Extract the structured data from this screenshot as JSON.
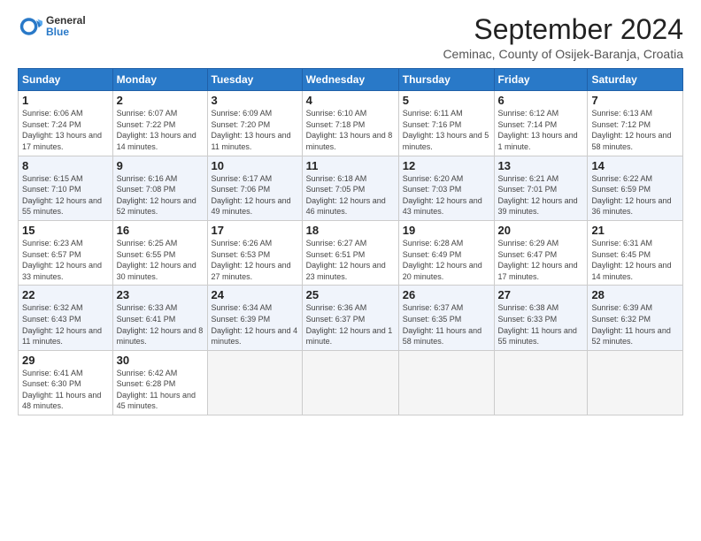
{
  "header": {
    "logo_general": "General",
    "logo_blue": "Blue",
    "month_title": "September 2024",
    "location": "Ceminac, County of Osijek-Baranja, Croatia"
  },
  "days_of_week": [
    "Sunday",
    "Monday",
    "Tuesday",
    "Wednesday",
    "Thursday",
    "Friday",
    "Saturday"
  ],
  "weeks": [
    [
      {
        "day": 1,
        "info": "Sunrise: 6:06 AM\nSunset: 7:24 PM\nDaylight: 13 hours and 17 minutes."
      },
      {
        "day": 2,
        "info": "Sunrise: 6:07 AM\nSunset: 7:22 PM\nDaylight: 13 hours and 14 minutes."
      },
      {
        "day": 3,
        "info": "Sunrise: 6:09 AM\nSunset: 7:20 PM\nDaylight: 13 hours and 11 minutes."
      },
      {
        "day": 4,
        "info": "Sunrise: 6:10 AM\nSunset: 7:18 PM\nDaylight: 13 hours and 8 minutes."
      },
      {
        "day": 5,
        "info": "Sunrise: 6:11 AM\nSunset: 7:16 PM\nDaylight: 13 hours and 5 minutes."
      },
      {
        "day": 6,
        "info": "Sunrise: 6:12 AM\nSunset: 7:14 PM\nDaylight: 13 hours and 1 minute."
      },
      {
        "day": 7,
        "info": "Sunrise: 6:13 AM\nSunset: 7:12 PM\nDaylight: 12 hours and 58 minutes."
      }
    ],
    [
      {
        "day": 8,
        "info": "Sunrise: 6:15 AM\nSunset: 7:10 PM\nDaylight: 12 hours and 55 minutes."
      },
      {
        "day": 9,
        "info": "Sunrise: 6:16 AM\nSunset: 7:08 PM\nDaylight: 12 hours and 52 minutes."
      },
      {
        "day": 10,
        "info": "Sunrise: 6:17 AM\nSunset: 7:06 PM\nDaylight: 12 hours and 49 minutes."
      },
      {
        "day": 11,
        "info": "Sunrise: 6:18 AM\nSunset: 7:05 PM\nDaylight: 12 hours and 46 minutes."
      },
      {
        "day": 12,
        "info": "Sunrise: 6:20 AM\nSunset: 7:03 PM\nDaylight: 12 hours and 43 minutes."
      },
      {
        "day": 13,
        "info": "Sunrise: 6:21 AM\nSunset: 7:01 PM\nDaylight: 12 hours and 39 minutes."
      },
      {
        "day": 14,
        "info": "Sunrise: 6:22 AM\nSunset: 6:59 PM\nDaylight: 12 hours and 36 minutes."
      }
    ],
    [
      {
        "day": 15,
        "info": "Sunrise: 6:23 AM\nSunset: 6:57 PM\nDaylight: 12 hours and 33 minutes."
      },
      {
        "day": 16,
        "info": "Sunrise: 6:25 AM\nSunset: 6:55 PM\nDaylight: 12 hours and 30 minutes."
      },
      {
        "day": 17,
        "info": "Sunrise: 6:26 AM\nSunset: 6:53 PM\nDaylight: 12 hours and 27 minutes."
      },
      {
        "day": 18,
        "info": "Sunrise: 6:27 AM\nSunset: 6:51 PM\nDaylight: 12 hours and 23 minutes."
      },
      {
        "day": 19,
        "info": "Sunrise: 6:28 AM\nSunset: 6:49 PM\nDaylight: 12 hours and 20 minutes."
      },
      {
        "day": 20,
        "info": "Sunrise: 6:29 AM\nSunset: 6:47 PM\nDaylight: 12 hours and 17 minutes."
      },
      {
        "day": 21,
        "info": "Sunrise: 6:31 AM\nSunset: 6:45 PM\nDaylight: 12 hours and 14 minutes."
      }
    ],
    [
      {
        "day": 22,
        "info": "Sunrise: 6:32 AM\nSunset: 6:43 PM\nDaylight: 12 hours and 11 minutes."
      },
      {
        "day": 23,
        "info": "Sunrise: 6:33 AM\nSunset: 6:41 PM\nDaylight: 12 hours and 8 minutes."
      },
      {
        "day": 24,
        "info": "Sunrise: 6:34 AM\nSunset: 6:39 PM\nDaylight: 12 hours and 4 minutes."
      },
      {
        "day": 25,
        "info": "Sunrise: 6:36 AM\nSunset: 6:37 PM\nDaylight: 12 hours and 1 minute."
      },
      {
        "day": 26,
        "info": "Sunrise: 6:37 AM\nSunset: 6:35 PM\nDaylight: 11 hours and 58 minutes."
      },
      {
        "day": 27,
        "info": "Sunrise: 6:38 AM\nSunset: 6:33 PM\nDaylight: 11 hours and 55 minutes."
      },
      {
        "day": 28,
        "info": "Sunrise: 6:39 AM\nSunset: 6:32 PM\nDaylight: 11 hours and 52 minutes."
      }
    ],
    [
      {
        "day": 29,
        "info": "Sunrise: 6:41 AM\nSunset: 6:30 PM\nDaylight: 11 hours and 48 minutes."
      },
      {
        "day": 30,
        "info": "Sunrise: 6:42 AM\nSunset: 6:28 PM\nDaylight: 11 hours and 45 minutes."
      },
      null,
      null,
      null,
      null,
      null
    ]
  ]
}
